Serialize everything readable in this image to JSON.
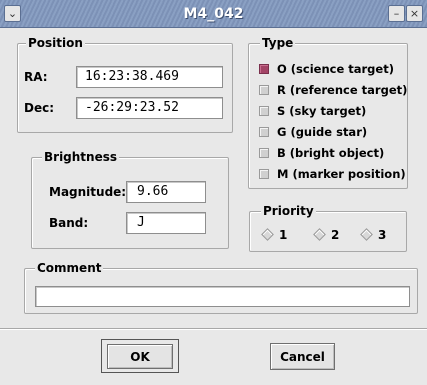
{
  "window": {
    "title": "M4_042"
  },
  "position": {
    "legend": "Position",
    "ra_label": "RA:",
    "ra_value": "16:23:38.469",
    "dec_label": "Dec:",
    "dec_value": "-26:29:23.52"
  },
  "brightness": {
    "legend": "Brightness",
    "magnitude_label": "Magnitude:",
    "magnitude_value": "9.66",
    "band_label": "Band:",
    "band_value": "J"
  },
  "type": {
    "legend": "Type",
    "options": [
      {
        "label": "O (science target)",
        "checked": true
      },
      {
        "label": "R (reference target)",
        "checked": false
      },
      {
        "label": "S (sky target)",
        "checked": false
      },
      {
        "label": "G (guide star)",
        "checked": false
      },
      {
        "label": "B (bright object)",
        "checked": false
      },
      {
        "label": "M (marker position)",
        "checked": false
      }
    ]
  },
  "priority": {
    "legend": "Priority",
    "options": [
      "1",
      "2",
      "3"
    ],
    "selected": null
  },
  "comment": {
    "legend": "Comment",
    "value": ""
  },
  "buttons": {
    "ok": "OK",
    "cancel": "Cancel"
  },
  "colors": {
    "titlebar": "#7c91b6",
    "checked": "#a34466",
    "background": "#e8e8e8"
  }
}
